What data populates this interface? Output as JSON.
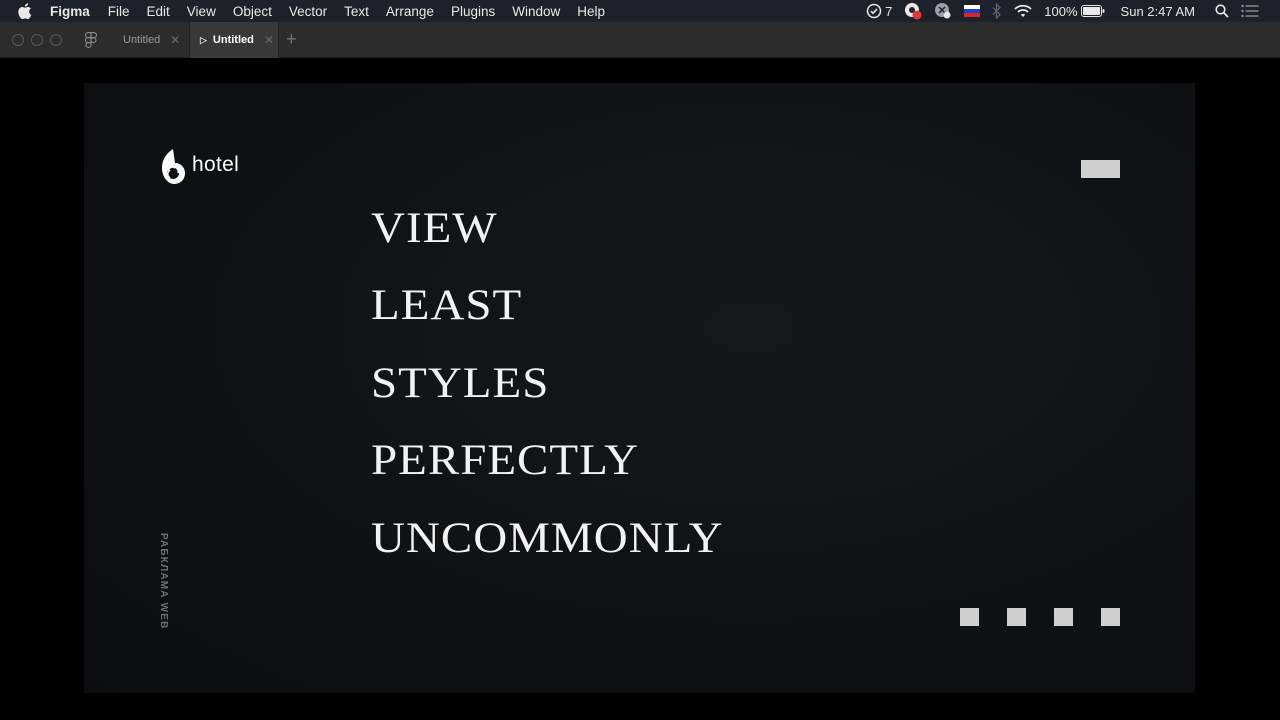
{
  "menubar": {
    "items": [
      "Figma",
      "File",
      "Edit",
      "View",
      "Object",
      "Vector",
      "Text",
      "Arrange",
      "Plugins",
      "Window",
      "Help"
    ],
    "status": {
      "todo_count": "7",
      "battery": "100%",
      "clock": "Sun 2:47 AM",
      "flag_colors": [
        "#ffffff",
        "#1c3fd4",
        "#e02424"
      ]
    }
  },
  "tabs": [
    {
      "label": "Untitled",
      "active": false
    },
    {
      "label": "Untitled",
      "active": true
    }
  ],
  "frame": {
    "logo_text": "hotel",
    "words": [
      "VIEW",
      "LEAST",
      "STYLES",
      "PERFECTLY",
      "UNCOMMONLY"
    ],
    "vertical_caption": "РАБКЛАМА WEB"
  },
  "colors": {
    "frame_bg": "#0f1113",
    "accent_grey": "#cfcfcf",
    "headline": "#f2f2f2"
  }
}
